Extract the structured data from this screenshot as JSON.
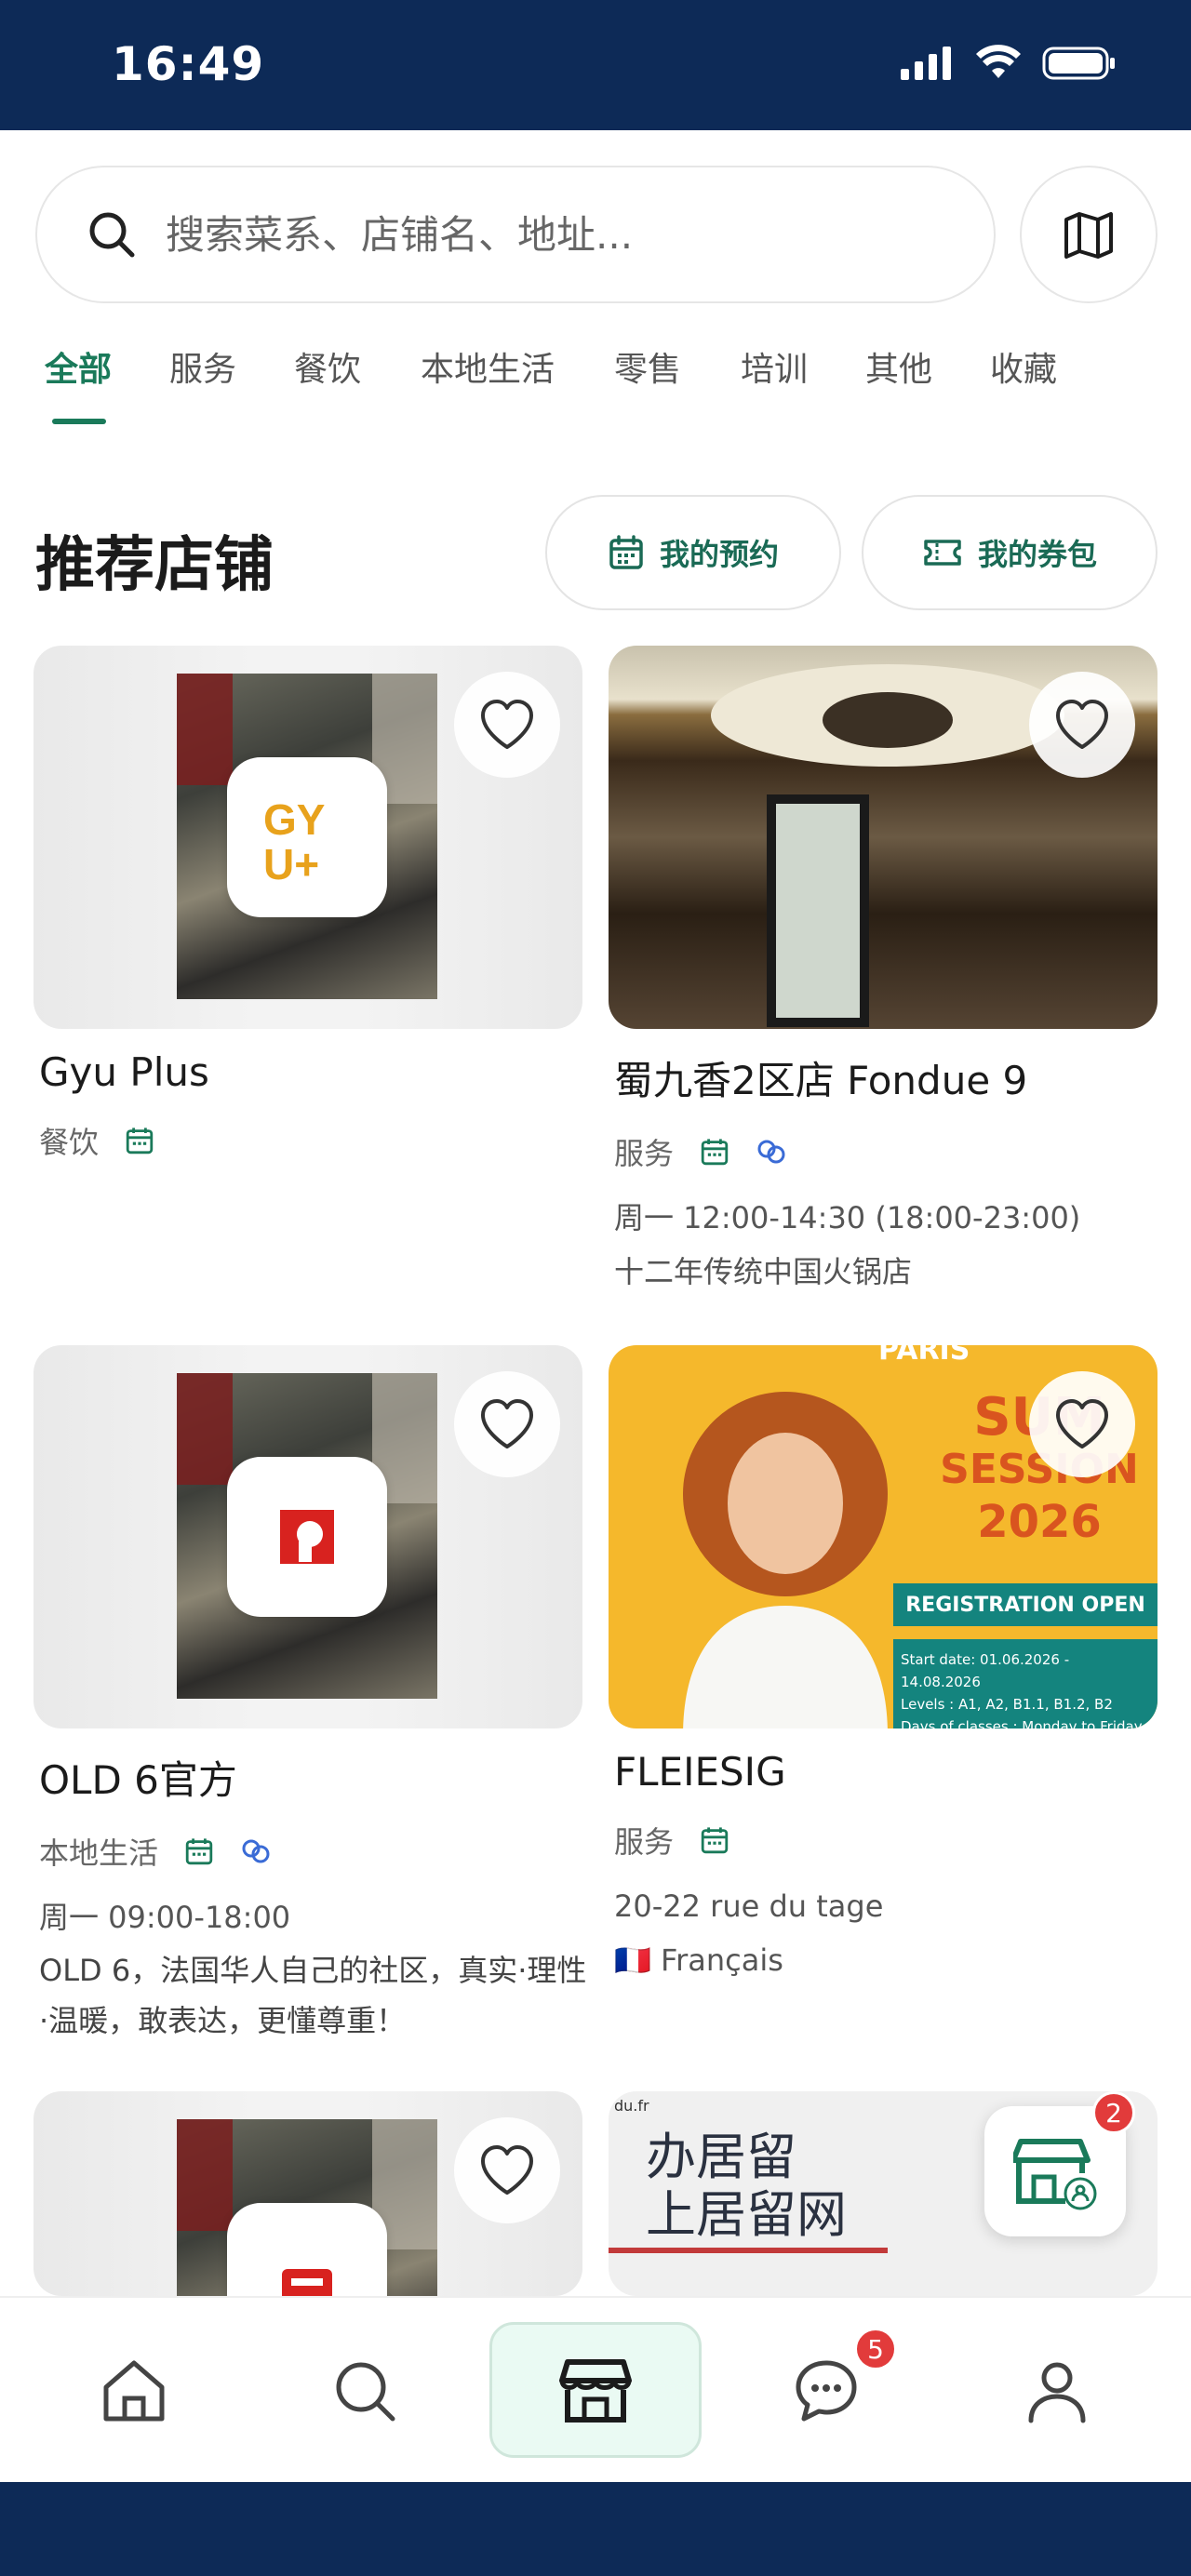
{
  "status_bar": {
    "time": "16:49"
  },
  "search": {
    "placeholder": "搜索菜系、店铺名、地址..."
  },
  "tabs": [
    {
      "label": "全部",
      "active": true
    },
    {
      "label": "服务"
    },
    {
      "label": "餐饮"
    },
    {
      "label": "本地生活"
    },
    {
      "label": "零售"
    },
    {
      "label": "培训"
    },
    {
      "label": "其他"
    },
    {
      "label": "收藏"
    }
  ],
  "section": {
    "title": "推荐店铺",
    "my_reservations": "我的预约",
    "my_coupons": "我的券包"
  },
  "stores": [
    {
      "name": "Gyu Plus",
      "category": "餐饮",
      "logo_text": "GY U+"
    },
    {
      "name": "蜀九香2区店 Fondue 9",
      "category": "服务",
      "hours": "周一 12:00-14:30 (18:00-23:00)",
      "description": "十二年传统中国火锅店"
    },
    {
      "name": "OLD 6官方",
      "category": "本地生活",
      "hours": "周一 09:00-18:00",
      "description": "OLD 6，法国华人自己的社区，真实·理性·温暖，敢表达，更懂尊重！"
    },
    {
      "name": "FLEIESIG",
      "category": "服务",
      "address": "20-22 rue du tage",
      "language": "Français",
      "language_flag": "🇫🇷",
      "poster": {
        "top": "PARIS",
        "title_line1": "SUM",
        "title_line2": "SESSION",
        "title_line3": "2026",
        "registration": "REGISTRATION OPEN",
        "start_date": "Start date: 01.06.2026 - 14.08.2026",
        "levels": "Levels : A1, A2, B1.1, B1.2, B2",
        "days": "Days of classes : Monday to Friday"
      }
    },
    {
      "name": "",
      "category": ""
    },
    {
      "name": "",
      "category": "",
      "poster": {
        "url": "du.fr",
        "line1": "办居留",
        "line2": "上居留网"
      }
    }
  ],
  "floating_shop_badge": "2",
  "bottom_nav": {
    "items": [
      "home-icon",
      "search-icon",
      "store-icon",
      "chat-icon",
      "profile-icon"
    ],
    "chat_badge": "5"
  },
  "colors": {
    "brand": "#1a7a5a",
    "status_bar": "#0d2a57",
    "badge": "#e23b3b"
  }
}
